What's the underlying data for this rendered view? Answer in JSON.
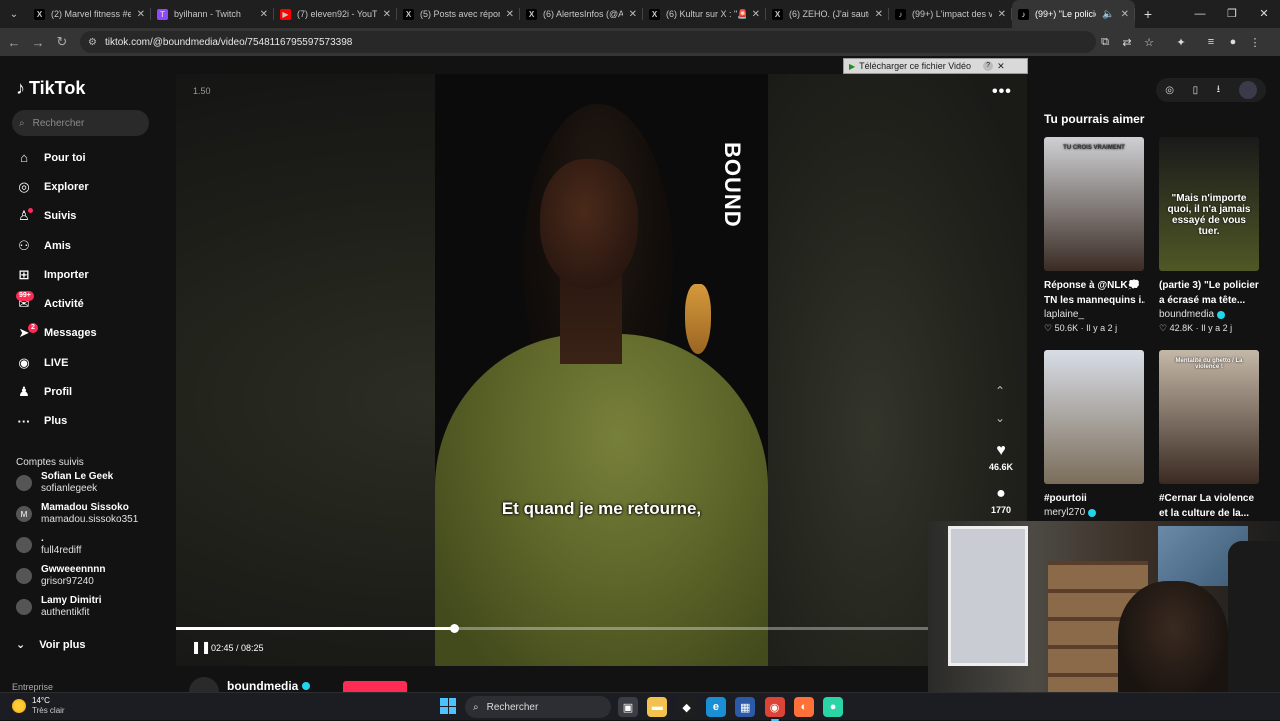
{
  "browser": {
    "tabs": [
      {
        "label": "(2) Marvel fitness #e",
        "icon": "x-icon",
        "favicon_text": "X",
        "favicon_bg": "#000000"
      },
      {
        "label": "byilhann - Twitch",
        "icon": "twitch-icon",
        "favicon_text": "T",
        "favicon_bg": "#9146ff"
      },
      {
        "label": "(7) eleven92i - YouTu",
        "icon": "youtube-icon",
        "favicon_text": "▶",
        "favicon_bg": "#ff0000"
      },
      {
        "label": "(5) Posts avec répons",
        "icon": "x-icon",
        "favicon_text": "X",
        "favicon_bg": "#000000"
      },
      {
        "label": "(6) AlertesInfos (@Al",
        "icon": "x-icon",
        "favicon_text": "X",
        "favicon_bg": "#000000"
      },
      {
        "label": "(6) Kultur sur X : \"🚨",
        "icon": "x-icon",
        "favicon_text": "X",
        "favicon_bg": "#000000"
      },
      {
        "label": "(6) ZEHO. (J'ai sauté)",
        "icon": "x-icon",
        "favicon_text": "X",
        "favicon_bg": "#000000"
      },
      {
        "label": "(99+) L'impact des vi",
        "icon": "tiktok-icon",
        "favicon_text": "♪",
        "favicon_bg": "#000000"
      },
      {
        "label": "(99+) \"Le policier",
        "icon": "tiktok-icon",
        "favicon_text": "♪",
        "favicon_bg": "#000000"
      }
    ],
    "url": "tiktok.com/@boundmedia/video/7548116795597573398"
  },
  "sidebar": {
    "logo": "TikTok",
    "search_placeholder": "Rechercher",
    "nav": [
      {
        "label": "Pour toi",
        "icon": "home-icon",
        "glyph": "⌂"
      },
      {
        "label": "Explorer",
        "icon": "compass-icon",
        "glyph": "◎"
      },
      {
        "label": "Suivis",
        "icon": "following-icon",
        "glyph": "♙"
      },
      {
        "label": "Amis",
        "icon": "friends-icon",
        "glyph": "⚇"
      },
      {
        "label": "Importer",
        "icon": "upload-icon",
        "glyph": "⊞"
      },
      {
        "label": "Activité",
        "icon": "activity-icon",
        "glyph": "✉",
        "badge": "99+"
      },
      {
        "label": "Messages",
        "icon": "messages-icon",
        "glyph": "➤",
        "badge": "2"
      },
      {
        "label": "LIVE",
        "icon": "live-icon",
        "glyph": "◉"
      },
      {
        "label": "Profil",
        "icon": "profile-icon",
        "glyph": "♟"
      },
      {
        "label": "Plus",
        "icon": "more-icon",
        "glyph": "···"
      }
    ],
    "following_title": "Comptes suivis",
    "following": [
      {
        "name": "Sofian Le Geek",
        "handle": "sofianlegeek"
      },
      {
        "name": "Mamadou Sissoko",
        "handle": "mamadou.sissoko351",
        "initial": "M"
      },
      {
        "name": ".",
        "handle": "full4rediff"
      },
      {
        "name": "Gwweeennnn",
        "handle": "grisor97240"
      },
      {
        "name": "Lamy Dimitri",
        "handle": "authentikfit"
      }
    ],
    "see_more": "Voir plus",
    "footer_peek": "Entreprise"
  },
  "video": {
    "speed": "1.50",
    "brand_mark": "BOUND",
    "subtitle": "Et quand je me retourne,",
    "time": "02:45 / 08:25",
    "progress": 0.327,
    "likes": "46.6K",
    "comments": "1770",
    "author": "boundmedia"
  },
  "download_bar": {
    "label": "Télécharger ce fichier Vidéo",
    "help": "?"
  },
  "right_panel": {
    "title": "Tu pourrais aimer",
    "cards": [
      {
        "line1": "Réponse à @NLK💭",
        "line2": "TN les mannequins i...",
        "user": "laplaine_",
        "verified": false,
        "stat": "♡ 50.6K · Il y a 2 j",
        "overlay": "TU CROIS VRAIMENT",
        "colors": [
          "#cfd0d4",
          "#3a2c24"
        ]
      },
      {
        "line1": "(partie 3) \"Le policier",
        "line2": "a écrasé ma tête...",
        "user": "boundmedia",
        "verified": true,
        "stat": "♡ 42.8K · Il y a 2 j",
        "overlay": "\"Mais n'importe quoi, il n'a jamais essayé de vous tuer.",
        "colors": [
          "#1a1a1a",
          "#4f5826"
        ]
      },
      {
        "line1": "#pourtoii",
        "line2": "",
        "user": "meryl270",
        "verified": true,
        "stat": "",
        "overlay": "",
        "colors": [
          "#d8dde6",
          "#7a6d5a"
        ]
      },
      {
        "line1": "#Cernar La violence",
        "line2": "et la culture de la...",
        "user": "",
        "verified": false,
        "stat": "",
        "overlay": "Mentalité du ghetto / La violence !",
        "colors": [
          "#c4b8a8",
          "#3a2a22"
        ]
      }
    ]
  },
  "taskbar": {
    "temp": "14°C",
    "weather": "Très clair",
    "search": "Rechercher",
    "apps": [
      {
        "name": "task-view-icon",
        "glyph": "▣",
        "bg": "#3a3d44"
      },
      {
        "name": "file-explorer-icon",
        "glyph": "▬",
        "bg": "#f2c14e"
      },
      {
        "name": "nvidia-icon",
        "glyph": "◆",
        "bg": "#1e1e1e"
      },
      {
        "name": "edge-icon",
        "glyph": "e",
        "bg": "#1a8fd4"
      },
      {
        "name": "store-icon",
        "glyph": "▦",
        "bg": "#2b5aa8"
      },
      {
        "name": "chrome-icon",
        "glyph": "◉",
        "bg": "#db4437"
      },
      {
        "name": "firefox-icon",
        "glyph": "◐",
        "bg": "#ff7139"
      },
      {
        "name": "app-icon",
        "glyph": "●",
        "bg": "#2bd4a6"
      }
    ]
  }
}
